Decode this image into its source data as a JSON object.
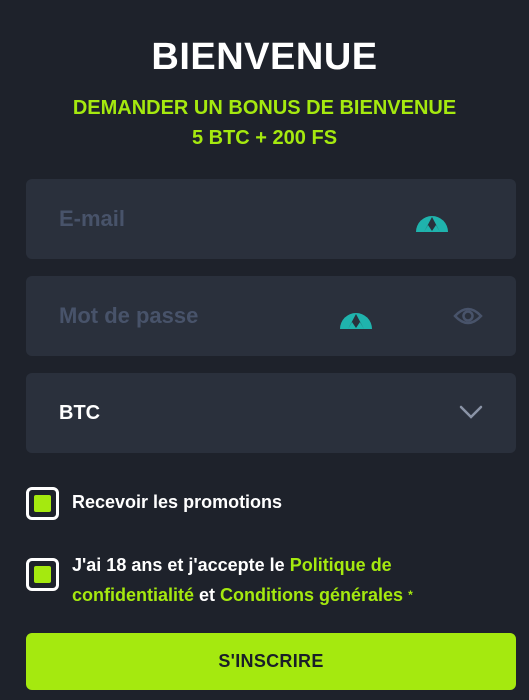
{
  "header": {
    "title": "BIENVENUE",
    "bonus_line1": "DEMANDER UN BONUS DE BIENVENUE",
    "bonus_line2": "5 BTC + 200 FS"
  },
  "form": {
    "email_placeholder": "E-mail",
    "password_placeholder": "Mot de passe",
    "currency_value": "BTC"
  },
  "checkboxes": {
    "promotions": {
      "label": "Recevoir les promotions",
      "checked": true
    },
    "terms": {
      "checked": true,
      "text_prefix": "J'ai 18 ans et j'accepte le ",
      "privacy_link": "Politique de confidentialité",
      "text_middle": " et ",
      "terms_link": "Conditions générales",
      "required_mark": "*"
    }
  },
  "submit_label": "S'INSCRIRE",
  "colors": {
    "background": "#1e222b",
    "field_background": "#2a303c",
    "accent": "#a5e90f",
    "placeholder": "#48536a",
    "icon_teal": "#1fb3ad"
  },
  "icons": {
    "autofill": "nordpass-mountain-icon",
    "password_visibility": "eye-icon",
    "dropdown": "chevron-down-icon"
  }
}
